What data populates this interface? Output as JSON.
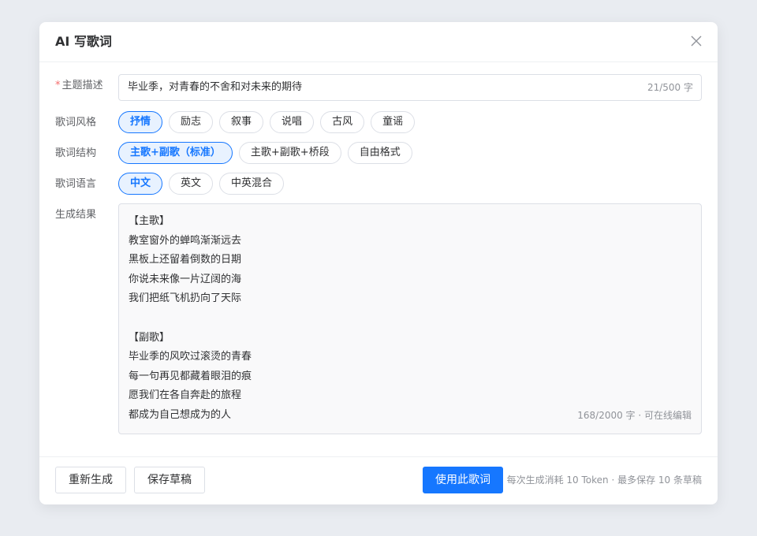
{
  "dialog": {
    "title": "AI 写歌词",
    "close_icon": "close-icon"
  },
  "topic": {
    "required_mark": "*",
    "label": "主题描述",
    "value": "毕业季，对青春的不舍和对未来的期待",
    "counter": "21/500 字"
  },
  "style": {
    "label": "歌词风格",
    "selected": "抒情",
    "options": [
      "抒情",
      "励志",
      "叙事",
      "说唱",
      "古风",
      "童谣"
    ]
  },
  "structure": {
    "label": "歌词结构",
    "selected": "主歌+副歌（标准）",
    "options": [
      "主歌+副歌（标准）",
      "主歌+副歌+桥段",
      "自由格式"
    ]
  },
  "language": {
    "label": "歌词语言",
    "selected": "中文",
    "options": [
      "中文",
      "英文",
      "中英混合"
    ]
  },
  "result": {
    "label": "生成结果",
    "lines": [
      "【主歌】",
      "教室窗外的蝉鸣渐渐远去",
      "黑板上还留着倒数的日期",
      "你说未来像一片辽阔的海",
      "我们把纸飞机扔向了天际",
      "",
      "【副歌】",
      "毕业季的风吹过滚烫的青春",
      "每一句再见都藏着眼泪的痕",
      "愿我们在各自奔赴的旅程",
      "都成为自己想成为的人"
    ],
    "counter": "168/2000 字 · 可在线编辑"
  },
  "footer": {
    "regenerate_label": "重新生成",
    "save_draft_label": "保存草稿",
    "use_label": "使用此歌词",
    "hint": "每次生成消耗 10 Token · 最多保存 10 条草稿"
  },
  "colors": {
    "primary": "#1677ff",
    "required": "#f56c6c"
  }
}
